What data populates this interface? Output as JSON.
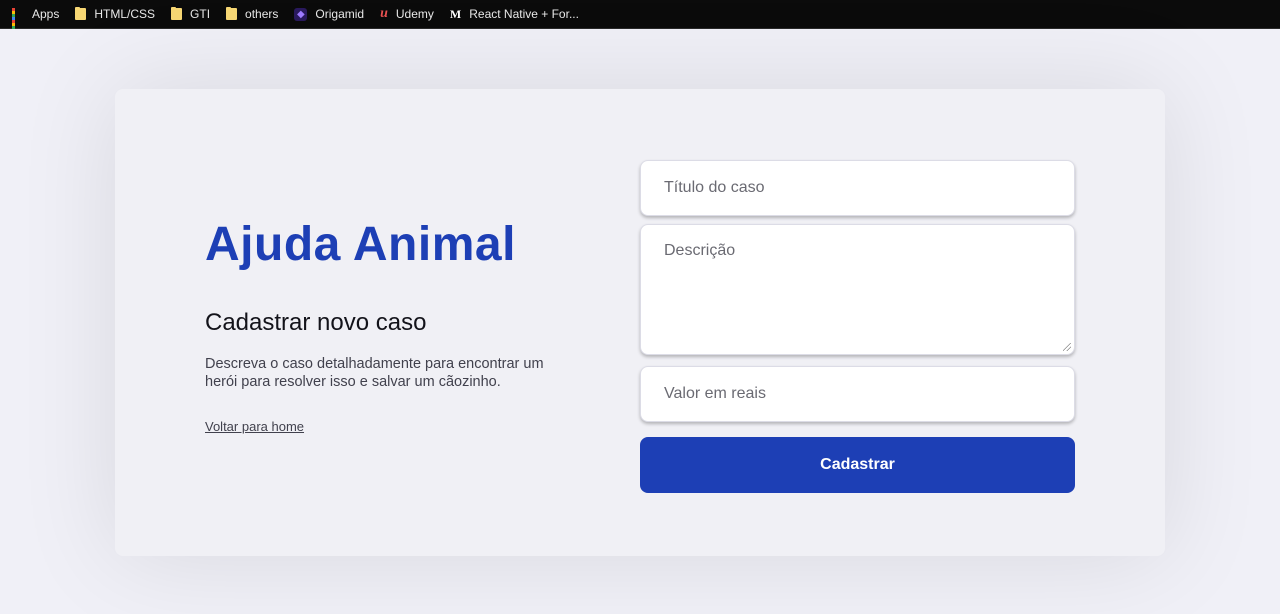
{
  "bookmarks": [
    {
      "label": "Apps",
      "icon": "apps-grid-icon"
    },
    {
      "label": "HTML/CSS",
      "icon": "folder-icon"
    },
    {
      "label": "GTI",
      "icon": "folder-icon"
    },
    {
      "label": "others",
      "icon": "folder-icon"
    },
    {
      "label": "Origamid",
      "icon": "origamid-icon"
    },
    {
      "label": "Udemy",
      "icon": "udemy-icon"
    },
    {
      "label": "React Native + For...",
      "icon": "medium-icon"
    }
  ],
  "brand": {
    "name": "Ajuda Animal",
    "color": "#1d3fb5"
  },
  "section": {
    "heading": "Cadastrar novo caso",
    "description": "Descreva o caso detalhadamente para encontrar um herói para resolver isso e salvar um cãozinho.",
    "back_link": "Voltar para home"
  },
  "form": {
    "title_placeholder": "Título do caso",
    "description_placeholder": "Descrição",
    "value_placeholder": "Valor em reais",
    "submit_label": "Cadastrar"
  }
}
